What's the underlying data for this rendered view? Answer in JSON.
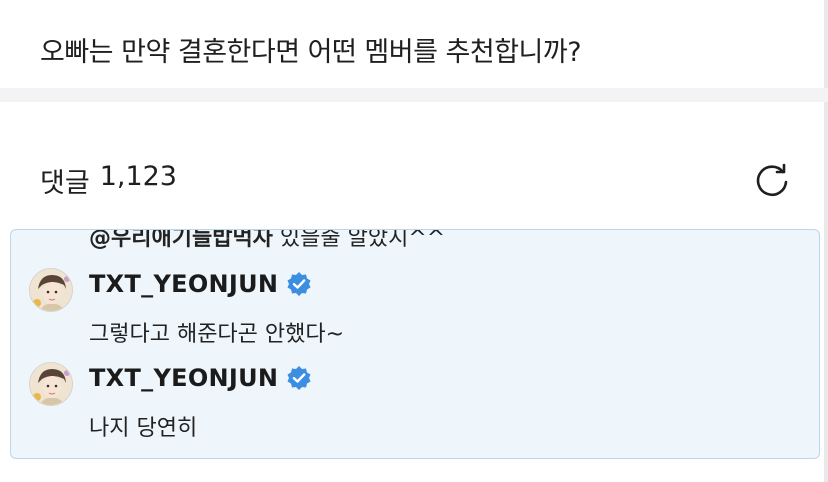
{
  "question": {
    "title": "오빠는 만약 결혼한다면 어떤 멤버를 추천합니까?"
  },
  "comments": {
    "label": "댓글",
    "count": "1,123",
    "refresh_icon": "refresh-icon"
  },
  "thread": {
    "previous": {
      "mention": "@우리애기늘밥먹자",
      "text": "있을줄 알았지^^"
    },
    "replies": [
      {
        "author": "TXT_YEONJUN",
        "verified": true,
        "text": "그렇다고 해준다곤 안했다~"
      },
      {
        "author": "TXT_YEONJUN",
        "verified": true,
        "text": "나지 당연히"
      }
    ]
  },
  "colors": {
    "reply_box_bg": "#eef5fb",
    "reply_box_border": "#bcd7ea",
    "verified_badge": "#3b8ee0",
    "divider": "#f3f3f5"
  }
}
